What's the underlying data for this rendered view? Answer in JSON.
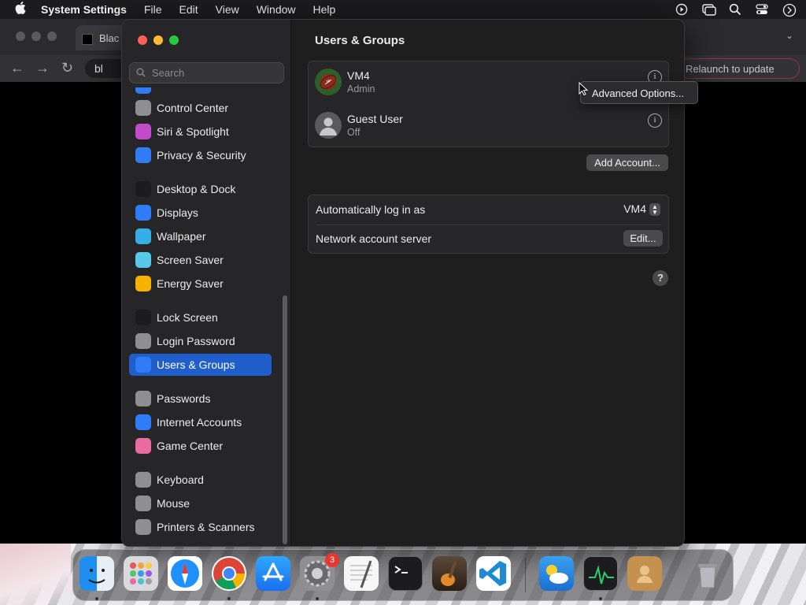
{
  "menubar": {
    "app_name": "System Settings",
    "items": [
      "File",
      "Edit",
      "View",
      "Window",
      "Help"
    ]
  },
  "browser": {
    "tab_title": "Blac",
    "url_fragment": "bl",
    "relaunch_label": "Relaunch to update"
  },
  "settings": {
    "search_placeholder": "Search",
    "sidebar": {
      "items": [
        {
          "label": "Control Center",
          "icon": "control-center-icon",
          "color": "#8e8e93"
        },
        {
          "label": "Siri & Spotlight",
          "icon": "siri-icon",
          "color": "#c04cc9"
        },
        {
          "label": "Privacy & Security",
          "icon": "hand-icon",
          "color": "#2f7cf6"
        },
        {
          "label": "Desktop & Dock",
          "icon": "desktop-dock-icon",
          "color": "#1c1c1e"
        },
        {
          "label": "Displays",
          "icon": "displays-icon",
          "color": "#2f7cf6"
        },
        {
          "label": "Wallpaper",
          "icon": "wallpaper-icon",
          "color": "#35aee6"
        },
        {
          "label": "Screen Saver",
          "icon": "screen-saver-icon",
          "color": "#5ac8e8"
        },
        {
          "label": "Energy Saver",
          "icon": "energy-saver-icon",
          "color": "#f5b300"
        },
        {
          "label": "Lock Screen",
          "icon": "lock-screen-icon",
          "color": "#1c1c1e"
        },
        {
          "label": "Login Password",
          "icon": "login-password-icon",
          "color": "#8e8e93"
        },
        {
          "label": "Users & Groups",
          "icon": "users-groups-icon",
          "color": "#2f7cf6"
        },
        {
          "label": "Passwords",
          "icon": "key-icon",
          "color": "#8e8e93"
        },
        {
          "label": "Internet Accounts",
          "icon": "at-icon",
          "color": "#2f7cf6"
        },
        {
          "label": "Game Center",
          "icon": "game-center-icon",
          "color": "#e86ca0"
        },
        {
          "label": "Keyboard",
          "icon": "keyboard-icon",
          "color": "#8e8e93"
        },
        {
          "label": "Mouse",
          "icon": "mouse-icon",
          "color": "#8e8e93"
        },
        {
          "label": "Printers & Scanners",
          "icon": "printer-icon",
          "color": "#8e8e93"
        }
      ],
      "selected": "Users & Groups"
    },
    "main": {
      "title": "Users & Groups",
      "users": [
        {
          "name": "VM4",
          "role": "Admin"
        },
        {
          "name": "Guest User",
          "role": "Off"
        }
      ],
      "add_account_label": "Add Account...",
      "auto_login_label": "Automatically log in as",
      "auto_login_value": "VM4",
      "network_server_label": "Network account server",
      "edit_label": "Edit...",
      "help_label": "?"
    },
    "popover_label": "Advanced Options..."
  },
  "dock": {
    "apps": [
      "Finder",
      "Launchpad",
      "Safari",
      "Google Chrome",
      "App Store",
      "System Settings",
      "TextEdit",
      "Terminal",
      "GarageBand",
      "Visual Studio Code",
      "Weather",
      "Activity Monitor",
      "Contacts",
      "Trash"
    ],
    "settings_badge": "3"
  },
  "colors": {
    "accent": "#1f5ecb",
    "close": "#ff5f57",
    "minimize": "#febc2e",
    "zoom": "#28c840"
  }
}
